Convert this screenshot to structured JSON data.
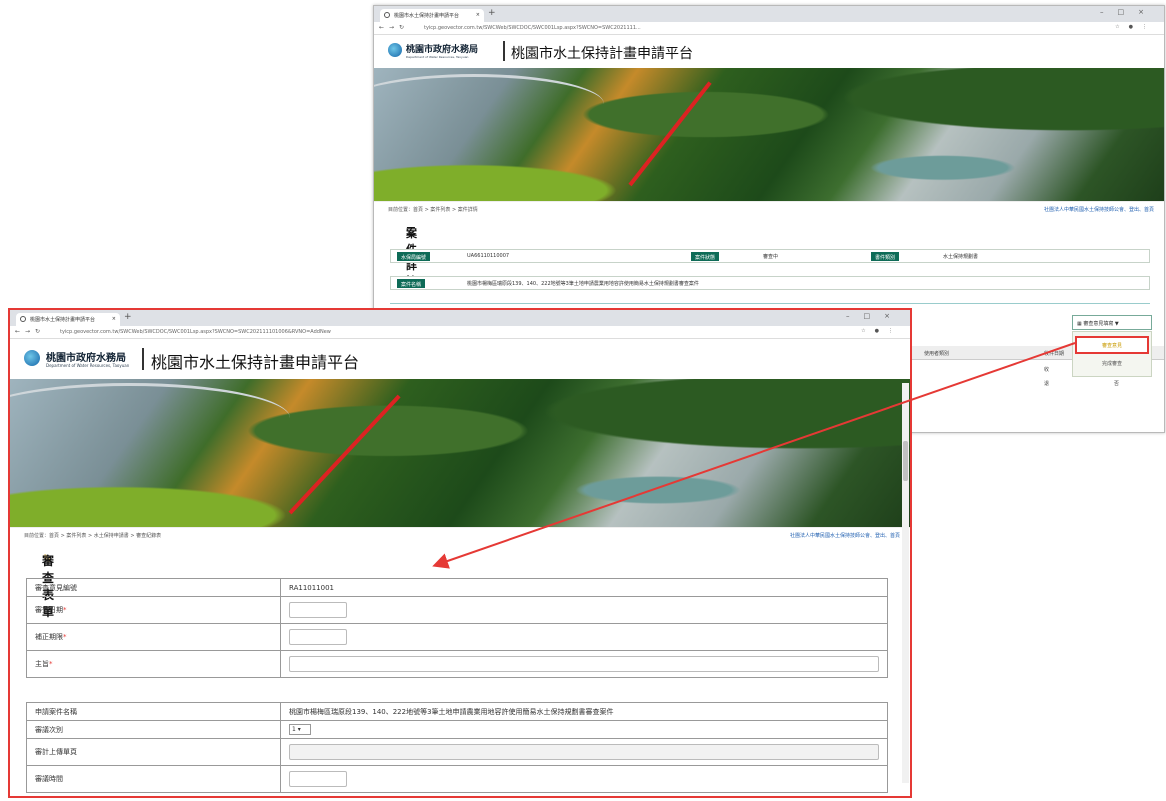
{
  "back_window": {
    "tab_title": "桃園市水土保持計畫申請平台",
    "url": "tyicp.geovector.com.tw/SWCWeb/SWCDOC/SWC001Lsp.aspx?SWCNO=SWC2021111...",
    "org_name": "桃園市政府水務局",
    "org_sub": "Department of Water Resources, Taoyuan",
    "platform_title": "桃園市水土保持計畫申請平台",
    "breadcrumb": "目前位置：首頁 > 案件列表 > 案件詳情",
    "right_link": "社團法人中華民國水土保持技師公會、登出、首頁",
    "section_title": "案件詳情",
    "fields": [
      {
        "label": "水保局編號",
        "value": "UA66110110007"
      },
      {
        "label": "案件狀態",
        "value": "審查中"
      },
      {
        "label": "書件類別",
        "value": "水土保持規劃書"
      }
    ],
    "case_name_label": "案件名稱",
    "case_name": "桃園市楊梅區瑞原段139、140、222地號等3筆土地申請農業用地容許使用簡易水土保持規劃書審查案件",
    "dropdown_button": "審查意見填寫 ▼",
    "dropdown_items": [
      "審查意見",
      "完成審查"
    ],
    "table_cols": [
      "使用者類別",
      "收件日期"
    ],
    "table_rows": [
      [
        "收",
        "是"
      ],
      [
        "退",
        "否"
      ]
    ]
  },
  "front_window": {
    "tab_title": "桃園市水土保持計畫申請平台",
    "url": "tyicp.geovector.com.tw/SWCWeb/SWCDOC/SWC001Lsp.aspx?SWCNO=SWC202111101006&RVNO=AddNew",
    "org_name": "桃園市政府水務局",
    "org_sub": "Department of Water Resources, Taoyuan",
    "platform_title": "桃園市水土保持計畫申請平台",
    "breadcrumb": "目前位置：首頁 > 案件列表 > 水土保持申請書 > 審查紀錄表",
    "right_link": "社團法人中華民國水土保持技師公會、登出、首頁",
    "section_title": "審查表單",
    "form1": [
      {
        "label": "審查意見編號",
        "value": "RA11011001",
        "required": false,
        "kind": "text"
      },
      {
        "label": "審查日期",
        "value": "",
        "required": true,
        "kind": "short"
      },
      {
        "label": "補正期限",
        "value": "",
        "required": true,
        "kind": "short"
      },
      {
        "label": "主旨",
        "value": "",
        "required": true,
        "kind": "long"
      }
    ],
    "form2": [
      {
        "label": "申請案件名稱",
        "value": "桃園市楊梅區瑞原段139、140、222地號等3筆土地申請農業用地容許使用簡易水土保持規劃書審查案件",
        "kind": "text"
      },
      {
        "label": "審議次別",
        "value": "1",
        "kind": "select"
      },
      {
        "label": "審計上傳單頁",
        "value": "",
        "kind": "disabled"
      },
      {
        "label": "審議時間",
        "value": "",
        "kind": "short"
      }
    ],
    "required_mark": "*"
  },
  "colors": {
    "highlight": "#e53935",
    "label_green": "#0e6b57",
    "link_blue": "#1f5fb0"
  },
  "icons": [
    "favicon-icon",
    "back-icon",
    "forward-icon",
    "reload-icon",
    "lock-icon",
    "pencil-icon",
    "list-icon",
    "user-icon",
    "calendar-icon"
  ]
}
